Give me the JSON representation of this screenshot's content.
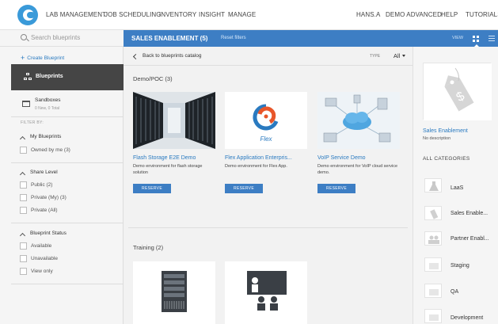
{
  "nav": {
    "items": [
      "LAB MANAGEMENT",
      "JOB SCHEDULING",
      "INVENTORY",
      "INSIGHT",
      "MANAGE"
    ],
    "user": "HANS.A",
    "right_items": [
      "DEMO ADVANCED",
      "HELP",
      "TUTORIALS"
    ]
  },
  "sidebar": {
    "search_placeholder": "Search blueprints",
    "create_label": "Create Blueprint",
    "blueprints_label": "Blueprints",
    "sandboxes_label": "Sandboxes",
    "sandboxes_sub": "0 New, 0 Total",
    "filter_by": "FILTER BY:",
    "my_blueprints_title": "My Blueprints",
    "owned_by_me": "Owned by me  (3)",
    "share_level_title": "Share Level",
    "public": "Public  (2)",
    "private_my": "Private (My)  (3)",
    "private_all": "Private (All)",
    "status_title": "Blueprint Status",
    "available": "Available",
    "unavailable": "Unavailable",
    "view_only": "View only"
  },
  "header": {
    "title": "SALES ENABLEMENT (5)",
    "reset": "Reset filters",
    "view": "VIEW"
  },
  "main": {
    "back": "Back to blueprints catalog",
    "type_label": "TYPE",
    "type_value": "All",
    "group1": "Demo/POC (3)",
    "group2": "Training (2)",
    "cards": [
      {
        "name": "Flash Storage E2E Demo",
        "desc": "Demo environment for flash storage solution",
        "button": "RESERVE"
      },
      {
        "name": "Flex Application Enterpris...",
        "desc": "Demo environment for Flex App.",
        "button": "RESERVE",
        "logo_text": "Flex"
      },
      {
        "name": "VoIP Service Demo",
        "desc": "Demo environment for VoIP cloud service demo.",
        "button": "RESERVE"
      }
    ]
  },
  "right_panel": {
    "name": "Sales Enablement",
    "desc": "No description",
    "all_categories": "ALL CATEGORIES",
    "categories": [
      "LaaS",
      "Sales Enable...",
      "Partner Enabl...",
      "Staging",
      "QA",
      "Development"
    ]
  },
  "colors": {
    "accent": "#3d7ec4",
    "link": "#2a7ac0",
    "sidebar_active": "#454545"
  }
}
